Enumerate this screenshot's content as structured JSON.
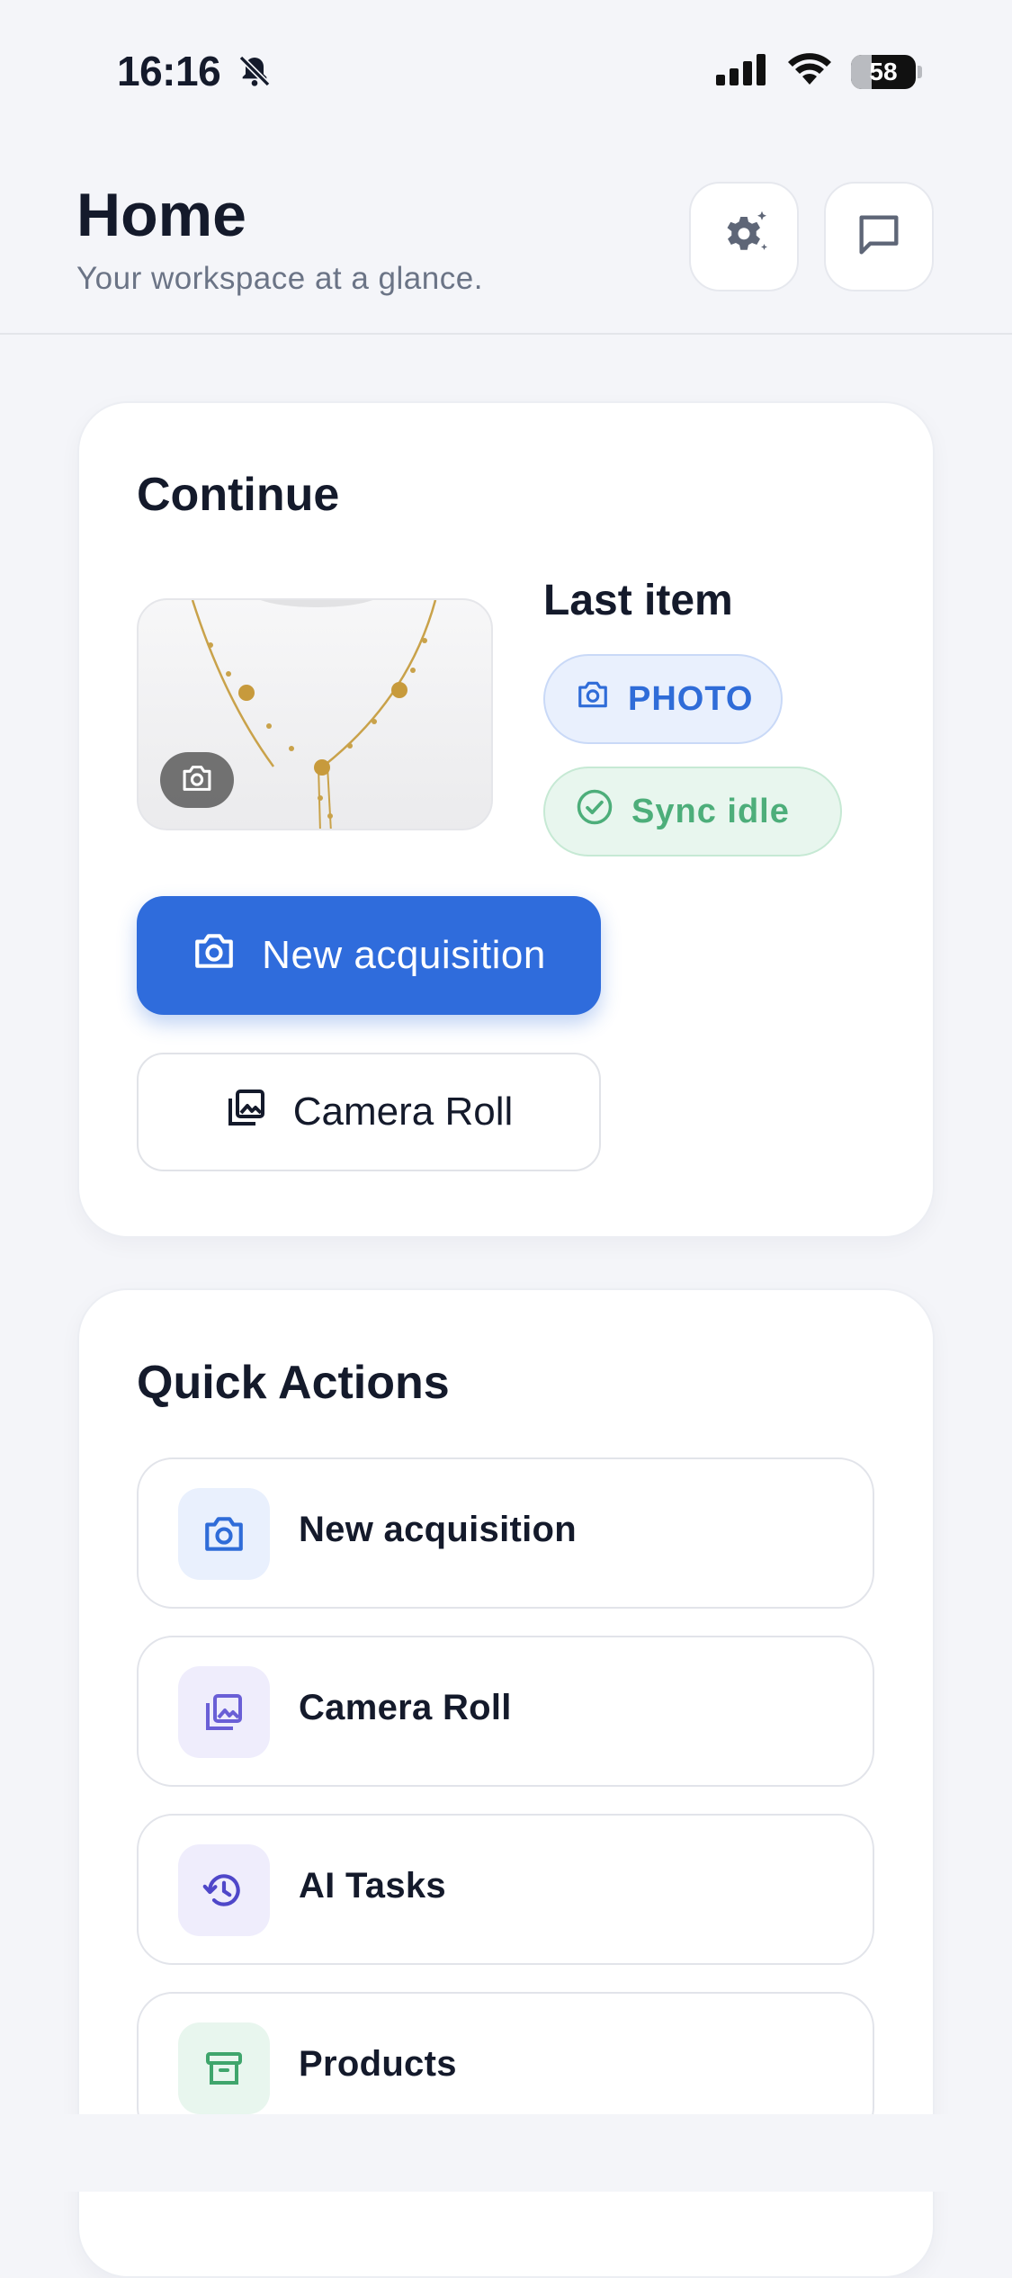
{
  "status_bar": {
    "time": "16:16",
    "battery": "58"
  },
  "header": {
    "title": "Home",
    "subtitle": "Your workspace at a glance."
  },
  "continue_card": {
    "title": "Continue",
    "last_item_label": "Last item",
    "type_badge": "PHOTO",
    "sync_badge": "Sync idle",
    "primary_button": "New acquisition",
    "secondary_button": "Camera Roll"
  },
  "quick_actions": {
    "title": "Quick Actions",
    "items": [
      {
        "label": "New acquisition",
        "icon": "camera-icon",
        "bg": "#e9f0fd",
        "color": "#2f6cd8"
      },
      {
        "label": "Camera Roll",
        "icon": "photo-library-icon",
        "bg": "#efedfc",
        "color": "#6a5fd6"
      },
      {
        "label": "AI Tasks",
        "icon": "history-icon",
        "bg": "#efedfc",
        "color": "#4f47c9"
      },
      {
        "label": "Products",
        "icon": "archive-box-icon",
        "bg": "#e8f6ee",
        "color": "#3fa56c"
      }
    ]
  },
  "colors": {
    "accent": "#2f6cdc",
    "success": "#4dae7a",
    "background": "#f4f5f9"
  }
}
